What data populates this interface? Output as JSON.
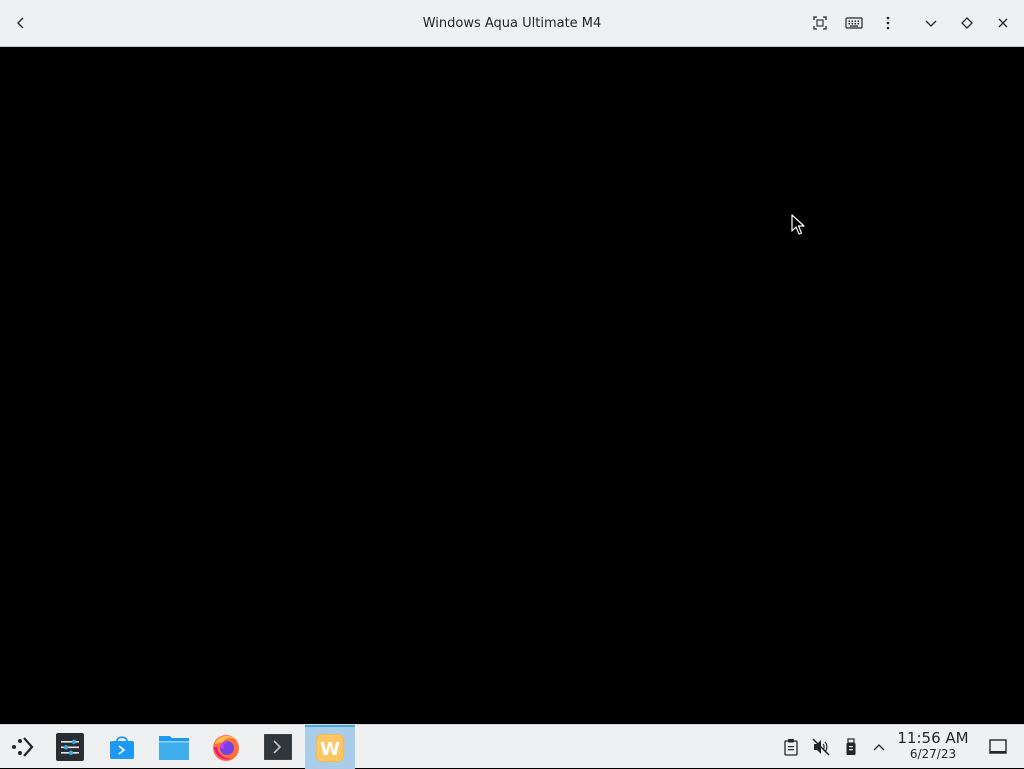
{
  "window": {
    "title": "Windows Aqua Ultimate M4"
  },
  "titlebar_icons": {
    "back": "chevron-left-icon",
    "fullscreen": "fullscreen-icon",
    "keyboard": "keyboard-icon",
    "menu": "kebab-menu-icon",
    "minimize": "chevron-down-icon",
    "maximize": "diamond-icon",
    "close": "close-icon"
  },
  "taskbar": {
    "launcher": "app-launcher-icon",
    "apps": [
      {
        "name": "System Settings",
        "icon": "settings-icon"
      },
      {
        "name": "Discover",
        "icon": "store-icon"
      },
      {
        "name": "Dolphin",
        "icon": "folder-icon"
      },
      {
        "name": "Firefox",
        "icon": "firefox-icon"
      },
      {
        "name": "Konsole",
        "icon": "terminal-icon"
      },
      {
        "name": "Winlator",
        "icon": "w-app-icon",
        "active": true
      }
    ],
    "tray": {
      "clipboard": "clipboard-icon",
      "volume": "volume-muted-icon",
      "storage": "usb-drive-icon",
      "expand": "chevron-up-icon"
    },
    "clock": {
      "time": "11:56 AM",
      "date": "6/27/23"
    },
    "show_desktop": "show-desktop-icon"
  },
  "colors": {
    "chrome_bg": "#eff0f1",
    "active_task": "#a9cce8",
    "accent": "#3daee9",
    "viewport_bg": "#000000"
  }
}
